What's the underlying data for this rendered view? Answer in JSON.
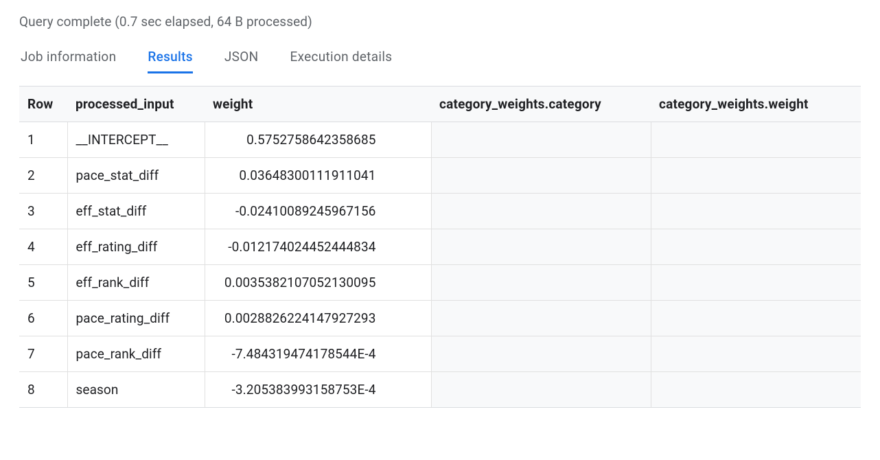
{
  "status": "Query complete (0.7 sec elapsed, 64 B processed)",
  "tabs": {
    "job_info": "Job information",
    "results": "Results",
    "json": "JSON",
    "exec_details": "Execution details"
  },
  "table": {
    "headers": {
      "row": "Row",
      "processed_input": "processed_input",
      "weight": "weight",
      "category": "category_weights.category",
      "cat_weight": "category_weights.weight"
    },
    "rows": [
      {
        "row": "1",
        "processed_input": "__INTERCEPT__",
        "weight": "0.5752758642358685",
        "category": "",
        "cat_weight": ""
      },
      {
        "row": "2",
        "processed_input": "pace_stat_diff",
        "weight": "0.03648300111911041",
        "category": "",
        "cat_weight": ""
      },
      {
        "row": "3",
        "processed_input": "eff_stat_diff",
        "weight": "-0.02410089245967156",
        "category": "",
        "cat_weight": ""
      },
      {
        "row": "4",
        "processed_input": "eff_rating_diff",
        "weight": "-0.012174024452444834",
        "category": "",
        "cat_weight": ""
      },
      {
        "row": "5",
        "processed_input": "eff_rank_diff",
        "weight": "0.0035382107052130095",
        "category": "",
        "cat_weight": ""
      },
      {
        "row": "6",
        "processed_input": "pace_rating_diff",
        "weight": "0.0028826224147927293",
        "category": "",
        "cat_weight": ""
      },
      {
        "row": "7",
        "processed_input": "pace_rank_diff",
        "weight": "-7.484319474178544E-4",
        "category": "",
        "cat_weight": ""
      },
      {
        "row": "8",
        "processed_input": "season",
        "weight": "-3.205383993158753E-4",
        "category": "",
        "cat_weight": ""
      }
    ]
  }
}
